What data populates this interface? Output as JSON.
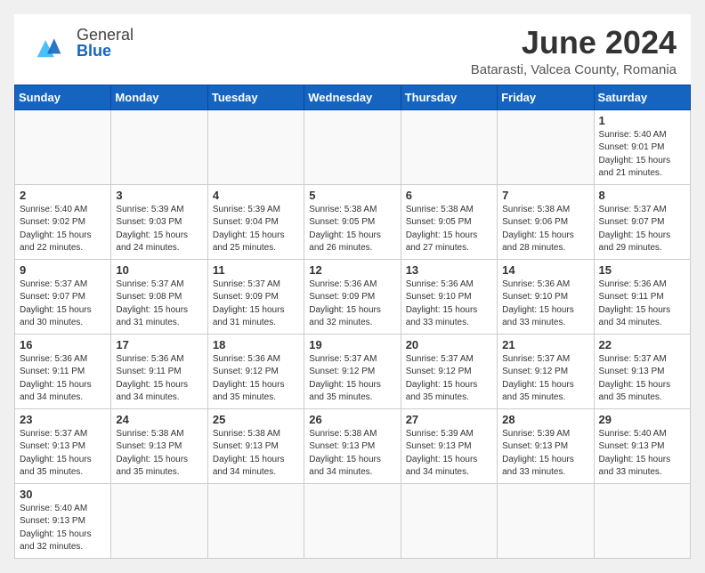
{
  "header": {
    "logo_general": "General",
    "logo_blue": "Blue",
    "month_title": "June 2024",
    "location": "Batarasti, Valcea County, Romania"
  },
  "days_of_week": [
    "Sunday",
    "Monday",
    "Tuesday",
    "Wednesday",
    "Thursday",
    "Friday",
    "Saturday"
  ],
  "weeks": [
    {
      "days": [
        {
          "num": "",
          "info": ""
        },
        {
          "num": "",
          "info": ""
        },
        {
          "num": "",
          "info": ""
        },
        {
          "num": "",
          "info": ""
        },
        {
          "num": "",
          "info": ""
        },
        {
          "num": "",
          "info": ""
        },
        {
          "num": "1",
          "info": "Sunrise: 5:40 AM\nSunset: 9:01 PM\nDaylight: 15 hours\nand 21 minutes."
        }
      ]
    },
    {
      "days": [
        {
          "num": "2",
          "info": "Sunrise: 5:40 AM\nSunset: 9:02 PM\nDaylight: 15 hours\nand 22 minutes."
        },
        {
          "num": "3",
          "info": "Sunrise: 5:39 AM\nSunset: 9:03 PM\nDaylight: 15 hours\nand 24 minutes."
        },
        {
          "num": "4",
          "info": "Sunrise: 5:39 AM\nSunset: 9:04 PM\nDaylight: 15 hours\nand 25 minutes."
        },
        {
          "num": "5",
          "info": "Sunrise: 5:38 AM\nSunset: 9:05 PM\nDaylight: 15 hours\nand 26 minutes."
        },
        {
          "num": "6",
          "info": "Sunrise: 5:38 AM\nSunset: 9:05 PM\nDaylight: 15 hours\nand 27 minutes."
        },
        {
          "num": "7",
          "info": "Sunrise: 5:38 AM\nSunset: 9:06 PM\nDaylight: 15 hours\nand 28 minutes."
        },
        {
          "num": "8",
          "info": "Sunrise: 5:37 AM\nSunset: 9:07 PM\nDaylight: 15 hours\nand 29 minutes."
        }
      ]
    },
    {
      "days": [
        {
          "num": "9",
          "info": "Sunrise: 5:37 AM\nSunset: 9:07 PM\nDaylight: 15 hours\nand 30 minutes."
        },
        {
          "num": "10",
          "info": "Sunrise: 5:37 AM\nSunset: 9:08 PM\nDaylight: 15 hours\nand 31 minutes."
        },
        {
          "num": "11",
          "info": "Sunrise: 5:37 AM\nSunset: 9:09 PM\nDaylight: 15 hours\nand 31 minutes."
        },
        {
          "num": "12",
          "info": "Sunrise: 5:36 AM\nSunset: 9:09 PM\nDaylight: 15 hours\nand 32 minutes."
        },
        {
          "num": "13",
          "info": "Sunrise: 5:36 AM\nSunset: 9:10 PM\nDaylight: 15 hours\nand 33 minutes."
        },
        {
          "num": "14",
          "info": "Sunrise: 5:36 AM\nSunset: 9:10 PM\nDaylight: 15 hours\nand 33 minutes."
        },
        {
          "num": "15",
          "info": "Sunrise: 5:36 AM\nSunset: 9:11 PM\nDaylight: 15 hours\nand 34 minutes."
        }
      ]
    },
    {
      "days": [
        {
          "num": "16",
          "info": "Sunrise: 5:36 AM\nSunset: 9:11 PM\nDaylight: 15 hours\nand 34 minutes."
        },
        {
          "num": "17",
          "info": "Sunrise: 5:36 AM\nSunset: 9:11 PM\nDaylight: 15 hours\nand 34 minutes."
        },
        {
          "num": "18",
          "info": "Sunrise: 5:36 AM\nSunset: 9:12 PM\nDaylight: 15 hours\nand 35 minutes."
        },
        {
          "num": "19",
          "info": "Sunrise: 5:37 AM\nSunset: 9:12 PM\nDaylight: 15 hours\nand 35 minutes."
        },
        {
          "num": "20",
          "info": "Sunrise: 5:37 AM\nSunset: 9:12 PM\nDaylight: 15 hours\nand 35 minutes."
        },
        {
          "num": "21",
          "info": "Sunrise: 5:37 AM\nSunset: 9:12 PM\nDaylight: 15 hours\nand 35 minutes."
        },
        {
          "num": "22",
          "info": "Sunrise: 5:37 AM\nSunset: 9:13 PM\nDaylight: 15 hours\nand 35 minutes."
        }
      ]
    },
    {
      "days": [
        {
          "num": "23",
          "info": "Sunrise: 5:37 AM\nSunset: 9:13 PM\nDaylight: 15 hours\nand 35 minutes."
        },
        {
          "num": "24",
          "info": "Sunrise: 5:38 AM\nSunset: 9:13 PM\nDaylight: 15 hours\nand 35 minutes."
        },
        {
          "num": "25",
          "info": "Sunrise: 5:38 AM\nSunset: 9:13 PM\nDaylight: 15 hours\nand 34 minutes."
        },
        {
          "num": "26",
          "info": "Sunrise: 5:38 AM\nSunset: 9:13 PM\nDaylight: 15 hours\nand 34 minutes."
        },
        {
          "num": "27",
          "info": "Sunrise: 5:39 AM\nSunset: 9:13 PM\nDaylight: 15 hours\nand 34 minutes."
        },
        {
          "num": "28",
          "info": "Sunrise: 5:39 AM\nSunset: 9:13 PM\nDaylight: 15 hours\nand 33 minutes."
        },
        {
          "num": "29",
          "info": "Sunrise: 5:40 AM\nSunset: 9:13 PM\nDaylight: 15 hours\nand 33 minutes."
        }
      ]
    },
    {
      "days": [
        {
          "num": "30",
          "info": "Sunrise: 5:40 AM\nSunset: 9:13 PM\nDaylight: 15 hours\nand 32 minutes."
        },
        {
          "num": "",
          "info": ""
        },
        {
          "num": "",
          "info": ""
        },
        {
          "num": "",
          "info": ""
        },
        {
          "num": "",
          "info": ""
        },
        {
          "num": "",
          "info": ""
        },
        {
          "num": "",
          "info": ""
        }
      ]
    }
  ]
}
